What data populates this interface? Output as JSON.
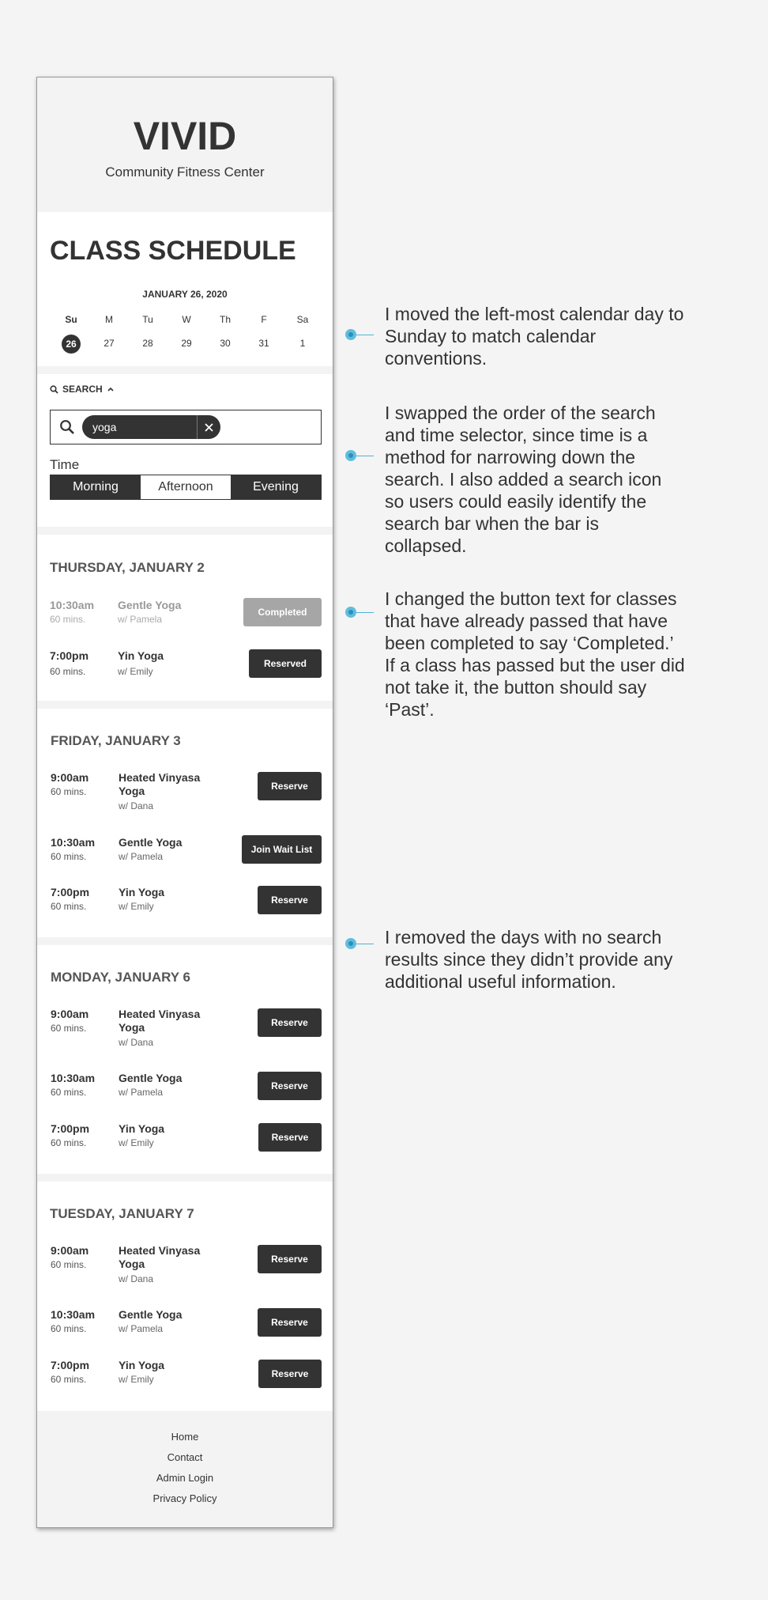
{
  "app": {
    "logo": "VIVID",
    "tagline": "Community Fitness Center"
  },
  "schedule": {
    "title": "CLASS SCHEDULE",
    "calendar": {
      "month_label": "JANUARY 26, 2020",
      "weekdays": [
        "Su",
        "M",
        "Tu",
        "W",
        "Th",
        "F",
        "Sa"
      ],
      "days": [
        "26",
        "27",
        "28",
        "29",
        "30",
        "31",
        "1"
      ],
      "selected_day": "26"
    },
    "search": {
      "toggle_label": "SEARCH",
      "query": "yoga"
    },
    "time_filter": {
      "label": "Time",
      "options": [
        "Morning",
        "Afternoon",
        "Evening"
      ],
      "selected": [
        "Morning",
        "Evening"
      ]
    },
    "days": [
      {
        "title": "THURSDAY, JANUARY 2",
        "classes": [
          {
            "time": "10:30am",
            "duration": "60 mins.",
            "name": "Gentle Yoga",
            "instructor": "w/ Pamela",
            "action": "Completed",
            "state": "completed"
          },
          {
            "time": "7:00pm",
            "duration": "60 mins.",
            "name": "Yin Yoga",
            "instructor": "w/ Emily",
            "action": "Reserved",
            "state": "reserved"
          }
        ]
      },
      {
        "title": "FRIDAY, JANUARY 3",
        "classes": [
          {
            "time": "9:00am",
            "duration": "60 mins.",
            "name": "Heated Vinyasa Yoga",
            "instructor": "w/ Dana",
            "action": "Reserve",
            "state": "open"
          },
          {
            "time": "10:30am",
            "duration": "60 mins.",
            "name": "Gentle Yoga",
            "instructor": "w/ Pamela",
            "action": "Join Wait List",
            "state": "waitlist"
          },
          {
            "time": "7:00pm",
            "duration": "60 mins.",
            "name": "Yin Yoga",
            "instructor": "w/ Emily",
            "action": "Reserve",
            "state": "open"
          }
        ]
      },
      {
        "title": "MONDAY, JANUARY 6",
        "classes": [
          {
            "time": "9:00am",
            "duration": "60 mins.",
            "name": "Heated Vinyasa Yoga",
            "instructor": "w/ Dana",
            "action": "Reserve",
            "state": "open"
          },
          {
            "time": "10:30am",
            "duration": "60 mins.",
            "name": "Gentle Yoga",
            "instructor": "w/ Pamela",
            "action": "Reserve",
            "state": "open"
          },
          {
            "time": "7:00pm",
            "duration": "60 mins.",
            "name": "Yin Yoga",
            "instructor": "w/ Emily",
            "action": "Reserve",
            "state": "open"
          }
        ]
      },
      {
        "title": "TUESDAY, JANUARY 7",
        "classes": [
          {
            "time": "9:00am",
            "duration": "60 mins.",
            "name": "Heated Vinyasa Yoga",
            "instructor": "w/ Dana",
            "action": "Reserve",
            "state": "open"
          },
          {
            "time": "10:30am",
            "duration": "60 mins.",
            "name": "Gentle Yoga",
            "instructor": "w/ Pamela",
            "action": "Reserve",
            "state": "open"
          },
          {
            "time": "7:00pm",
            "duration": "60 mins.",
            "name": "Yin Yoga",
            "instructor": "w/ Emily",
            "action": "Reserve",
            "state": "open"
          }
        ]
      }
    ]
  },
  "footer": {
    "links": [
      "Home",
      "Contact",
      "Admin Login",
      "Privacy Policy"
    ]
  },
  "annotations": [
    "I moved the left-most calendar day to Sunday to match calendar conventions.",
    "I swapped the order of the search and time selector, since time is a method for narrowing down the search. I also added a search icon so users could easily identify the search bar when the bar is collapsed.",
    "I changed the button text for classes that have already passed that have been completed to say ‘Completed.’ If a class has passed but the user did not take it, the button should say ‘Past’.",
    "I removed the days with no search results since they didn’t provide any additional useful information."
  ],
  "colors": {
    "accent": "#5fbde0",
    "dark": "#333333",
    "completed_button": "#a6a6a6",
    "band": "#f3f3f3",
    "background": "#f4f4f4"
  }
}
